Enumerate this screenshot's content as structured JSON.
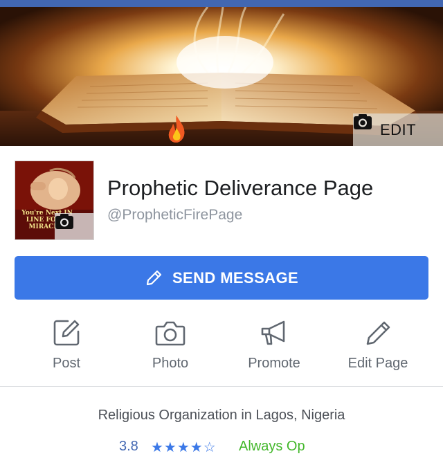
{
  "cover": {
    "edit_label": "EDIT"
  },
  "page": {
    "name": "Prophetic Deliverance Page",
    "handle": "@PropheticFirePage",
    "avatar_text": "You're Next IN LINE FOR A MIRACLE!"
  },
  "send_message": {
    "label": "SEND MESSAGE"
  },
  "actions": [
    {
      "label": "Post",
      "icon": "compose-icon"
    },
    {
      "label": "Photo",
      "icon": "camera-icon"
    },
    {
      "label": "Promote",
      "icon": "megaphone-icon"
    },
    {
      "label": "Edit Page",
      "icon": "pencil-icon"
    }
  ],
  "about": {
    "category": "Religious Organization in Lagos, Nigeria",
    "rating": "3.8",
    "stars": "★★★★☆",
    "availability": "Always Op"
  },
  "colors": {
    "brand_bar": "#4267b2",
    "send_button": "#3b78e7",
    "action_icon": "#606770"
  }
}
